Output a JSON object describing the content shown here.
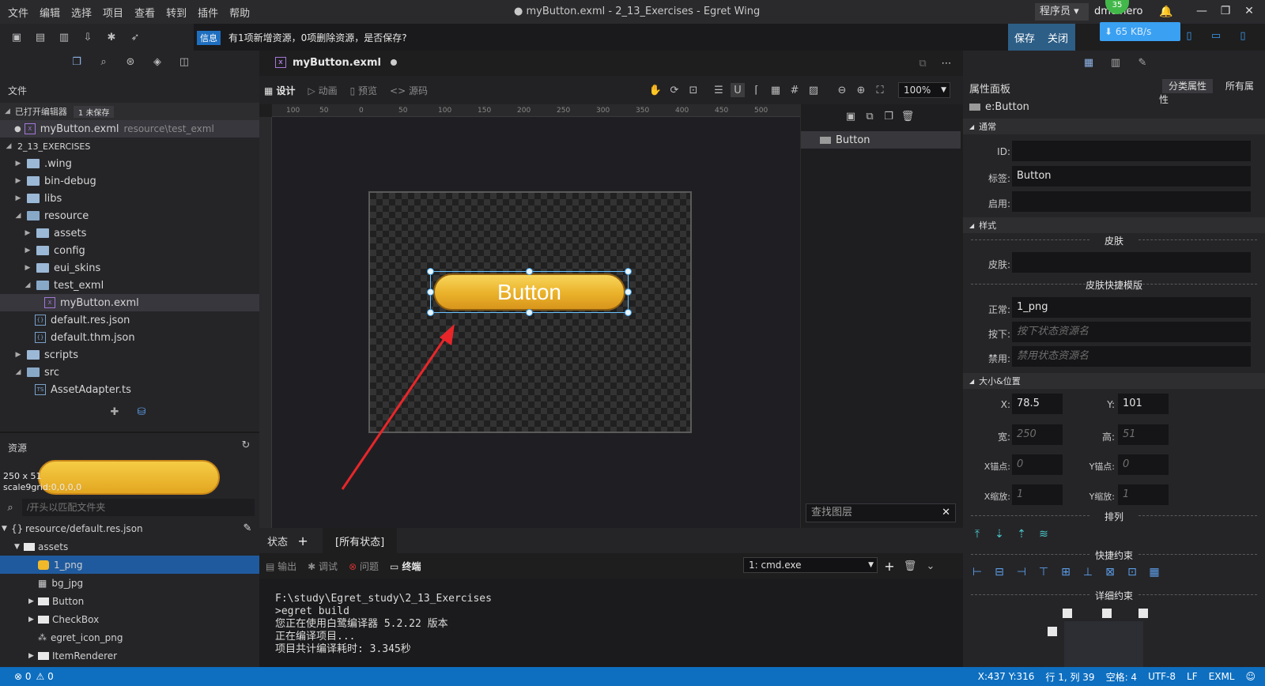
{
  "menu": [
    "文件",
    "编辑",
    "选择",
    "项目",
    "查看",
    "转到",
    "插件",
    "帮助"
  ],
  "window": {
    "title": "● myButton.exml - 2_13_Exercises - Egret Wing",
    "role": "程序员",
    "user": "dmc hero",
    "badge": "35",
    "net_speed": "65 KB/s"
  },
  "notice": {
    "tag": "信息",
    "message": "有1项新增资源，0项删除资源，是否保存?",
    "save": "保存",
    "close": "关闭"
  },
  "explorer": {
    "title": "文件",
    "opened_editors": "已打开编辑器",
    "unsaved": "1 未保存",
    "opened_file": "myButton.exml",
    "opened_path": "resource\\test_exml",
    "project": "2_13_EXERCISES",
    "items": [
      ".wing",
      "bin-debug",
      "libs",
      "resource",
      "assets",
      "config",
      "eui_skins",
      "test_exml",
      "myButton.exml",
      "default.res.json",
      "default.thm.json",
      "scripts",
      "src",
      "AssetAdapter.ts"
    ]
  },
  "resources": {
    "title": "资源",
    "size": "250 x 51",
    "scale9grid": "scale9grid:0,0,0,0",
    "search_placeholder": "/开头以匹配文件夹",
    "root": "resource/default.res.json",
    "items": [
      "assets",
      "1_png",
      "bg_jpg",
      "Button",
      "CheckBox",
      "egret_icon_png",
      "ItemRenderer"
    ]
  },
  "editor": {
    "tab": "myButton.exml",
    "modes": [
      "设计",
      "动画",
      "预览",
      "源码"
    ],
    "zoom": "100%",
    "ruler_top": [
      "100",
      "50",
      "0",
      "50",
      "100",
      "150",
      "200",
      "250",
      "300",
      "350",
      "400",
      "450",
      "500"
    ],
    "button_label": "Button",
    "layer_item": "Button",
    "layer_search": "查找图层",
    "state_label": "状态",
    "state_all": "[所有状态]"
  },
  "terminal": {
    "tabs": [
      "输出",
      "调试",
      "问题",
      "终端"
    ],
    "shell": "1: cmd.exe",
    "lines": [
      "F:\\study\\Egret_study\\2_13_Exercises",
      ">egret build",
      "您正在使用白鹭编译器 5.2.22 版本",
      "正在编译项目...",
      "项目共计编译耗时: 3.345秒"
    ]
  },
  "properties": {
    "title": "属性面板",
    "tab_category": "分类属性",
    "tab_all": "所有属性",
    "component": "e:Button",
    "groups": {
      "common": "通常",
      "style": "样式",
      "size_pos": "大小&位置"
    },
    "labels": {
      "id": "ID:",
      "label": "标签:",
      "enabled": "启用:",
      "skin_sec": "皮肤",
      "skin": "皮肤:",
      "skin_template": "皮肤快捷模版",
      "normal": "正常:",
      "down": "按下:",
      "disabled": "禁用:",
      "x": "X:",
      "y": "Y:",
      "w": "宽:",
      "h": "高:",
      "ax": "X锚点:",
      "ay": "Y锚点:",
      "sx": "X缩放:",
      "sy": "Y缩放:",
      "arrange": "排列",
      "quick_constraint": "快捷约束",
      "detail_constraint": "详细约束"
    },
    "values": {
      "label": "Button",
      "normal": "1_png",
      "down_ph": "按下状态资源名",
      "disabled_ph": "禁用状态资源名",
      "x": "78.5",
      "y": "101",
      "w": "250",
      "h": "51",
      "ax": "0",
      "ay": "0",
      "sx": "1",
      "sy": "1"
    }
  },
  "status": {
    "errors": "0",
    "warnings": "0",
    "cursor": "X:437 Y:316",
    "position": "行 1, 列 39",
    "spaces": "空格: 4",
    "encoding": "UTF-8",
    "eol": "LF",
    "language": "EXML"
  }
}
